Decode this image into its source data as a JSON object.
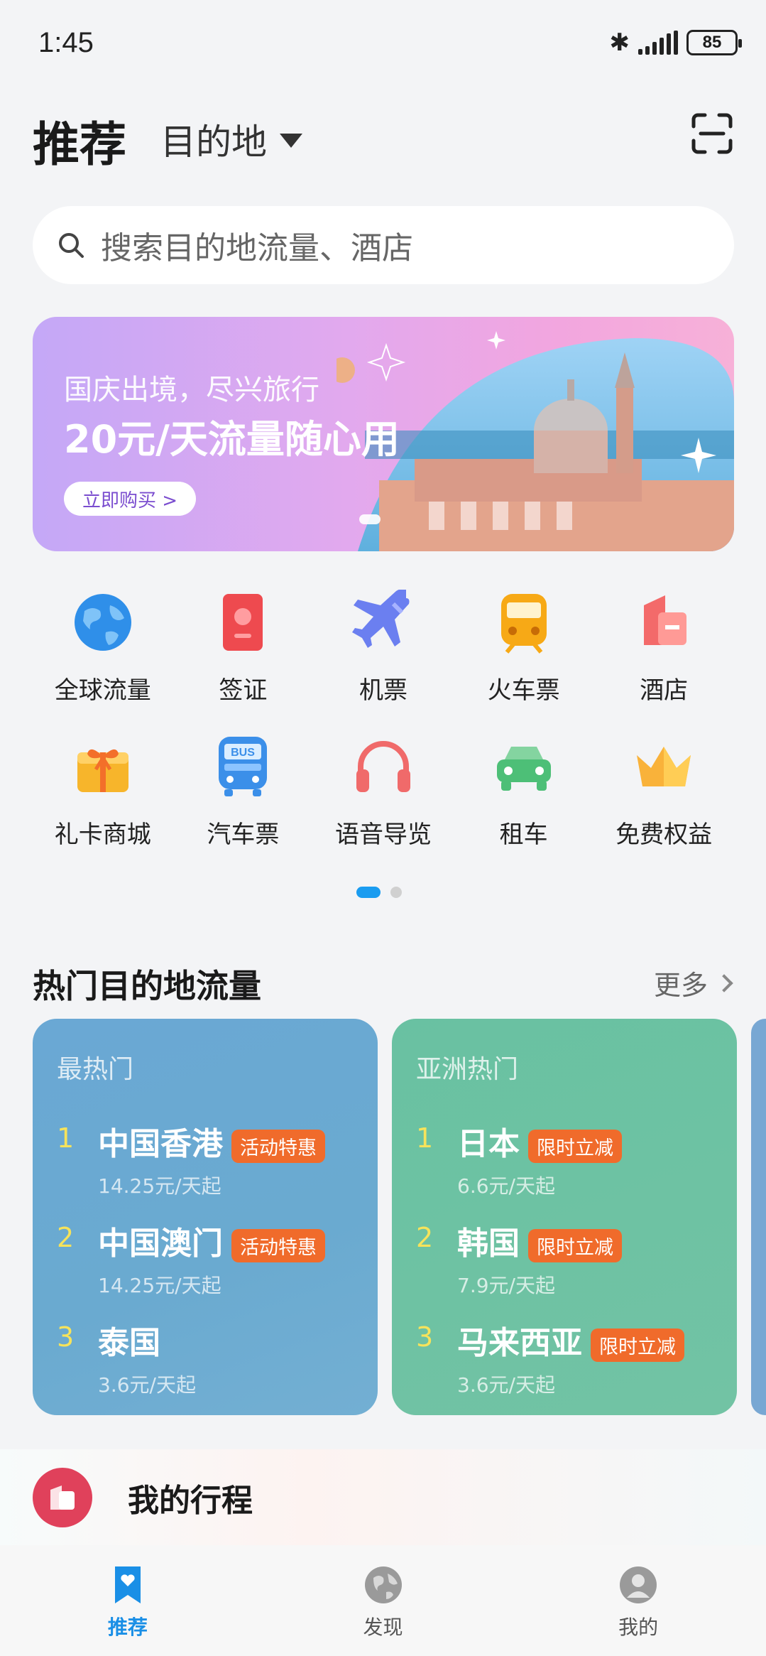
{
  "status": {
    "time": "1:45",
    "battery": "85"
  },
  "header": {
    "title": "推荐",
    "destination": "目的地"
  },
  "search": {
    "placeholder": "搜索目的地流量、酒店"
  },
  "banner": {
    "subtitle": "国庆出境，尽兴旅行",
    "headline": "20元/天流量随心用",
    "cta": "立即购买 >"
  },
  "services": [
    {
      "label": "全球流量",
      "icon": "globe-icon"
    },
    {
      "label": "签证",
      "icon": "visa-icon"
    },
    {
      "label": "机票",
      "icon": "airplane-icon"
    },
    {
      "label": "火车票",
      "icon": "train-icon"
    },
    {
      "label": "酒店",
      "icon": "hotel-icon"
    },
    {
      "label": "礼卡商城",
      "icon": "gift-icon"
    },
    {
      "label": "汽车票",
      "icon": "bus-icon",
      "badge": "BUS"
    },
    {
      "label": "语音导览",
      "icon": "headphones-icon"
    },
    {
      "label": "租车",
      "icon": "car-icon"
    },
    {
      "label": "免费权益",
      "icon": "crown-icon"
    }
  ],
  "hot": {
    "title": "热门目的地流量",
    "more": "更多",
    "cards": [
      {
        "header": "最热门",
        "items": [
          {
            "rank": "1",
            "name": "中国香港",
            "tag": "活动特惠",
            "price": "14.25元/天起"
          },
          {
            "rank": "2",
            "name": "中国澳门",
            "tag": "活动特惠",
            "price": "14.25元/天起"
          },
          {
            "rank": "3",
            "name": "泰国",
            "tag": "",
            "price": "3.6元/天起"
          }
        ]
      },
      {
        "header": "亚洲热门",
        "items": [
          {
            "rank": "1",
            "name": "日本",
            "tag": "限时立减",
            "price": "6.6元/天起"
          },
          {
            "rank": "2",
            "name": "韩国",
            "tag": "限时立减",
            "price": "7.9元/天起"
          },
          {
            "rank": "3",
            "name": "马来西亚",
            "tag": "限时立减",
            "price": "3.6元/天起"
          }
        ]
      }
    ]
  },
  "trip": {
    "label": "我的行程"
  },
  "nav": [
    {
      "label": "推荐",
      "icon": "bookmark-heart-icon",
      "active": true
    },
    {
      "label": "发现",
      "icon": "globe-icon",
      "active": false
    },
    {
      "label": "我的",
      "icon": "user-icon",
      "active": false
    }
  ],
  "colors": {
    "accent": "#1a8fe6",
    "tag": "#f06b2b",
    "card1": "#6aa8d4",
    "card2": "#69c1a2"
  }
}
